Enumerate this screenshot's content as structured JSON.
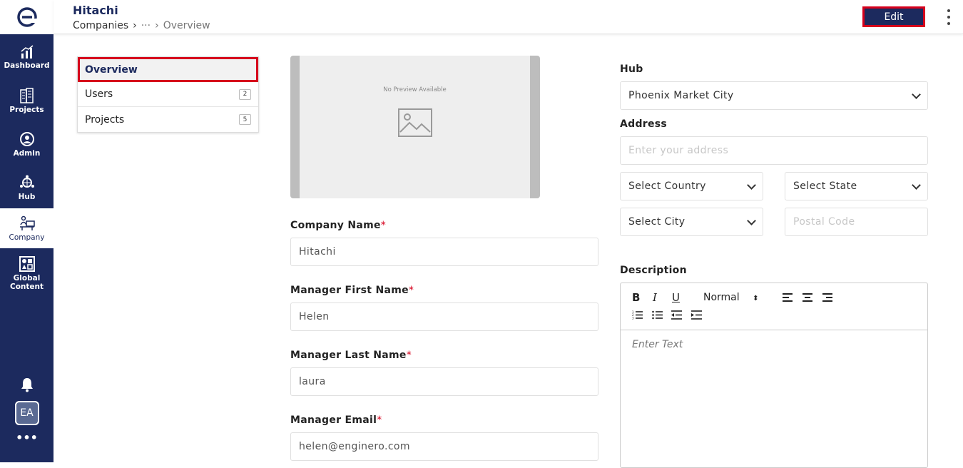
{
  "app": {
    "logo_letter": "e"
  },
  "rail": {
    "items": [
      {
        "label": "Dashboard",
        "icon": "chart-icon"
      },
      {
        "label": "Projects",
        "icon": "building-icon"
      },
      {
        "label": "Admin",
        "icon": "admin-icon"
      },
      {
        "label": "Hub",
        "icon": "hub-icon"
      },
      {
        "label": "Company",
        "icon": "company-icon",
        "active": true
      },
      {
        "label_line1": "Global",
        "label_line2": "Content",
        "icon": "global-content-icon"
      }
    ],
    "avatar": "EA"
  },
  "header": {
    "title": "Hitachi",
    "breadcrumb": {
      "root": "Companies",
      "ellipsis": "···",
      "current": "Overview"
    },
    "edit_label": "Edit"
  },
  "subnav": {
    "items": [
      {
        "label": "Overview"
      },
      {
        "label": "Users",
        "count": "2"
      },
      {
        "label": "Projects",
        "count": "5"
      }
    ]
  },
  "preview": {
    "text": "No Preview Available"
  },
  "form": {
    "company_name": {
      "label": "Company Name",
      "required": "*",
      "value": "Hitachi"
    },
    "manager_first": {
      "label": "Manager First Name",
      "required": "*",
      "value": "Helen"
    },
    "manager_last": {
      "label": "Manager Last Name",
      "required": "*",
      "value": "laura"
    },
    "manager_email": {
      "label": "Manager Email",
      "required": "*",
      "value": "helen@enginero.com"
    },
    "hub": {
      "label": "Hub",
      "value": "Phoenix Market City"
    },
    "address": {
      "label": "Address",
      "placeholder": "Enter your address"
    },
    "country": {
      "value": "Select Country"
    },
    "state": {
      "value": "Select State"
    },
    "city": {
      "value": "Select City"
    },
    "postal": {
      "placeholder": "Postal Code"
    },
    "description": {
      "label": "Description",
      "heading_select": "Normal",
      "placeholder": "Enter Text"
    }
  },
  "colors": {
    "navy": "#1c2a5e",
    "highlight": "#d6001c"
  }
}
